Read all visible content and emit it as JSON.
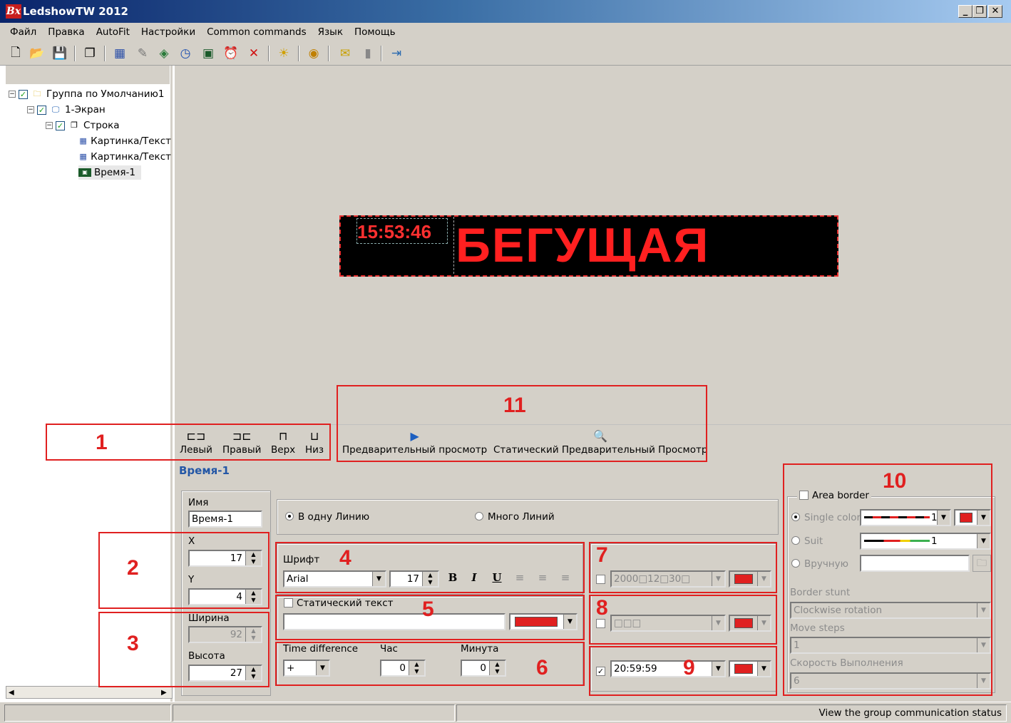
{
  "window": {
    "title": "LedshowTW 2012",
    "logo": "Bx",
    "minimize": "_",
    "restore": "❐",
    "close": "✕"
  },
  "menu": [
    "Файл",
    "Правка",
    "AutoFit",
    "Настройки",
    "Common commands",
    "Язык",
    "Помощь"
  ],
  "toolbar_icons": [
    "new-file-icon",
    "open-folder-icon",
    "save-icon",
    "screens-icon",
    "picture-text-icon",
    "subtitle-icon",
    "flash-icon",
    "clock-icon",
    "timer-icon",
    "alarm-icon",
    "delete-icon",
    "brightness-icon",
    "power-icon",
    "send-icon",
    "lamp-icon",
    "exit-icon"
  ],
  "tree": {
    "group": "Группа по Умолчанию1",
    "screen": "1-Экран",
    "program": "Строка",
    "items": [
      "Картинка/Текст",
      "Картинка/Текст",
      "Время-1"
    ]
  },
  "preview": {
    "clock": "15:53:46",
    "scroll_text": "БЕГУЩАЯ"
  },
  "align": {
    "left": "Левый",
    "right": "Правый",
    "top": "Верх",
    "bottom": "Низ"
  },
  "preview_buttons": {
    "preview": "Предварительный просмотр",
    "static_preview": "Статический Предварительный Просмотр"
  },
  "object_title": "Время-1",
  "props": {
    "name_label": "Имя",
    "name_value": "Время-1",
    "x_label": "X",
    "x_value": "17",
    "y_label": "Y",
    "y_value": "4",
    "width_label": "Ширина",
    "width_value": "92",
    "height_label": "Высота",
    "height_value": "27"
  },
  "lines": {
    "single": "В одну Линию",
    "multi": "Много Линий"
  },
  "font": {
    "label": "Шрифт",
    "name": "Arial",
    "size": "17",
    "bold": "B",
    "italic": "I",
    "underline": "U"
  },
  "static_text": {
    "label": "Статический текст",
    "value": ""
  },
  "time_diff": {
    "label": "Time difference",
    "sign": "+",
    "hour_label": "Час",
    "hour": "0",
    "minute_label": "Минута",
    "minute": "0"
  },
  "date_format": "2000□12□30□",
  "week_format": "□□□",
  "time_format": "20:59:59",
  "border": {
    "area_border": "Area border",
    "single_color": "Single color",
    "single_width": "1",
    "suit": "Suit",
    "suit_width": "1",
    "manual": "Вручную",
    "stunt_label": "Border stunt",
    "stunt_value": "Clockwise rotation",
    "steps_label": "Move steps",
    "steps_value": "1",
    "speed_label": "Скорость Выполнения",
    "speed_value": "6"
  },
  "annotations": [
    "1",
    "2",
    "3",
    "4",
    "5",
    "6",
    "7",
    "8",
    "9",
    "10",
    "11"
  ],
  "status": {
    "right": "View the group communication status"
  },
  "colors": {
    "accent_red": "#e02020",
    "led_red": "#ff2020",
    "title_blue": "#2457a6"
  }
}
